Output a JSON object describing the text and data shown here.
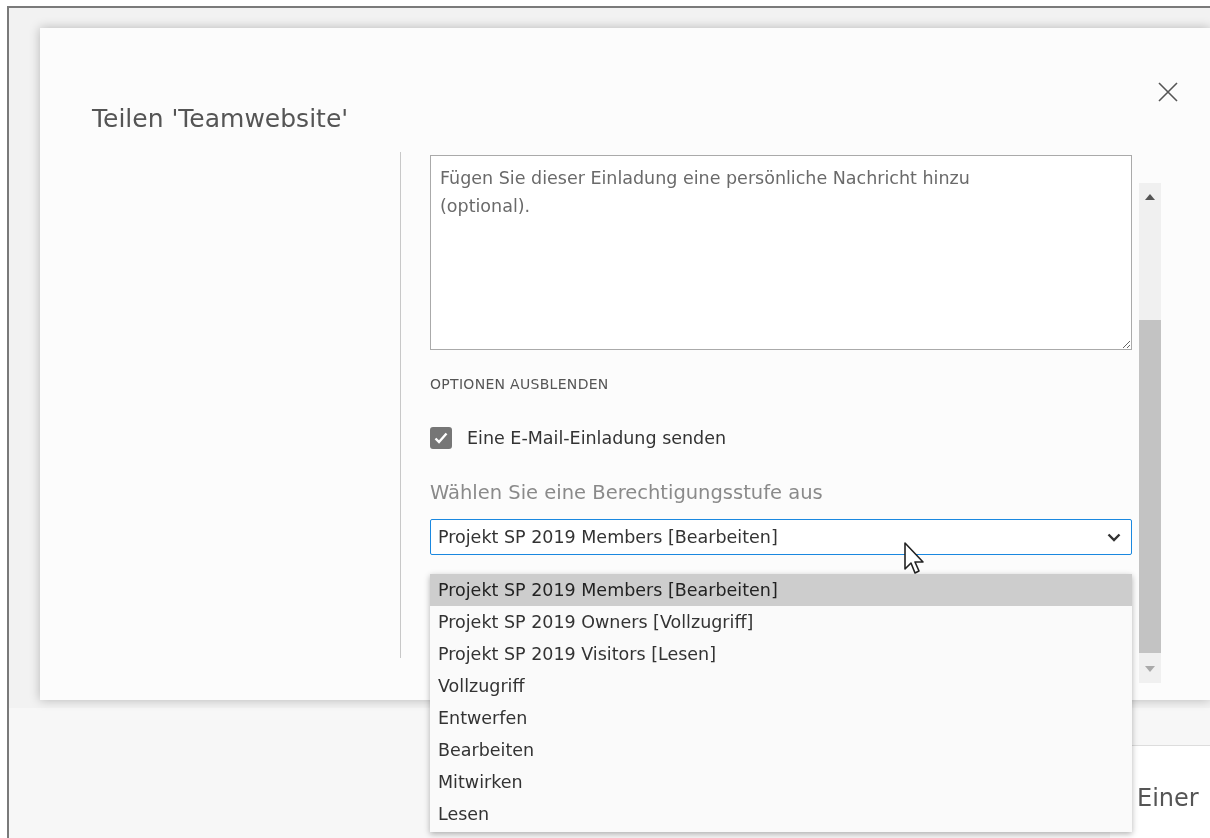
{
  "dialog": {
    "title": "Teilen 'Teamwebsite'",
    "message": {
      "placeholder": "Fügen Sie dieser Einladung eine persönliche Nachricht hinzu (optional)."
    },
    "options_toggle": "OPTIONEN AUSBLENDEN",
    "email_invite": {
      "label": "Eine E-Mail-Einladung senden",
      "checked": true
    },
    "permission": {
      "label": "Wählen Sie eine Berechtigungsstufe aus",
      "value": "Projekt SP 2019 Members [Bearbeiten]",
      "expanded": true,
      "options": [
        {
          "label": "Projekt SP 2019 Members [Bearbeiten]",
          "selected": true
        },
        {
          "label": "Projekt SP 2019 Owners [Vollzugriff]",
          "selected": false
        },
        {
          "label": "Projekt SP 2019 Visitors [Lesen]",
          "selected": false
        },
        {
          "label": "Vollzugriff",
          "selected": false
        },
        {
          "label": "Entwerfen",
          "selected": false
        },
        {
          "label": "Bearbeiten",
          "selected": false
        },
        {
          "label": "Mitwirken",
          "selected": false
        },
        {
          "label": "Lesen",
          "selected": false
        }
      ]
    }
  },
  "background": {
    "heading": "Einer"
  }
}
